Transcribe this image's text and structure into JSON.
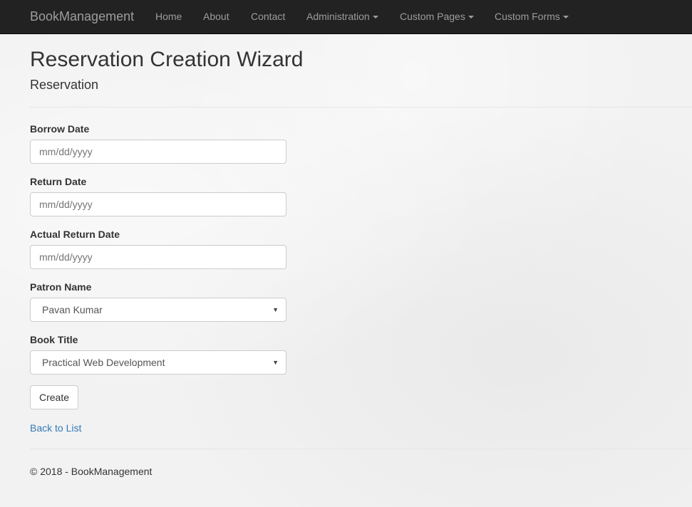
{
  "navbar": {
    "brand": "BookManagement",
    "items": [
      {
        "label": "Home"
      },
      {
        "label": "About"
      },
      {
        "label": "Contact"
      },
      {
        "label": "Administration",
        "dropdown": true
      },
      {
        "label": "Custom Pages",
        "dropdown": true
      },
      {
        "label": "Custom Forms",
        "dropdown": true
      }
    ]
  },
  "page": {
    "title": "Reservation Creation Wizard",
    "subtitle": "Reservation"
  },
  "form": {
    "borrow_date": {
      "label": "Borrow Date",
      "placeholder": "mm/dd/yyyy",
      "value": ""
    },
    "return_date": {
      "label": "Return Date",
      "placeholder": "mm/dd/yyyy",
      "value": ""
    },
    "actual_return_date": {
      "label": "Actual Return Date",
      "placeholder": "mm/dd/yyyy",
      "value": ""
    },
    "patron_name": {
      "label": "Patron Name",
      "selected": "Pavan Kumar"
    },
    "book_title": {
      "label": "Book Title",
      "selected": "Practical Web Development"
    },
    "create_label": "Create"
  },
  "links": {
    "back_to_list": "Back to List"
  },
  "footer": {
    "text": "© 2018 - BookManagement"
  },
  "icons": {
    "dropdown_caret": "caret-down-icon",
    "select_arrow": "select-arrow-icon"
  },
  "colors": {
    "navbar_bg": "#222222",
    "nav_text": "#9d9d9d",
    "link": "#337ab7"
  }
}
